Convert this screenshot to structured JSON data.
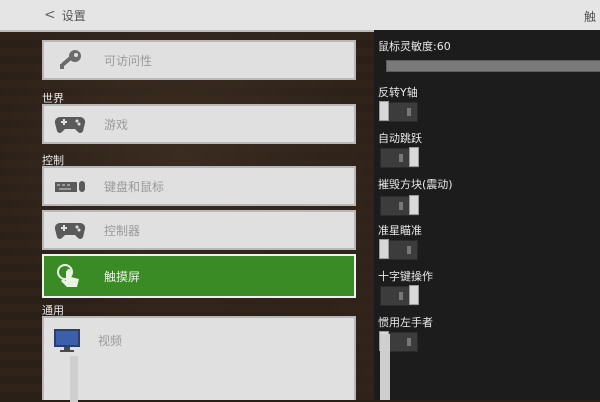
{
  "topbar": {
    "back_label": "设置",
    "right_text": "触"
  },
  "sections": {
    "world": "世界",
    "controls": "控制",
    "general": "通用"
  },
  "menu": {
    "accessibility": "可访问性",
    "game": "游戏",
    "keyboard_mouse": "键盘和鼠标",
    "controller": "控制器",
    "touch": "触摸屏",
    "video": "视频"
  },
  "options": {
    "sensitivity": "鼠标灵敏度:60",
    "invert_y": "反转Y轴",
    "auto_jump": "自动跳跃",
    "destroy_block": "摧毁方块(震动)",
    "crosshair": "准星瞄准",
    "dpad": "十字键操作",
    "left_handed": "惯用左手者"
  },
  "colors": {
    "active_green": "#3a8a26",
    "panel_gray": "#e0e0e0"
  }
}
